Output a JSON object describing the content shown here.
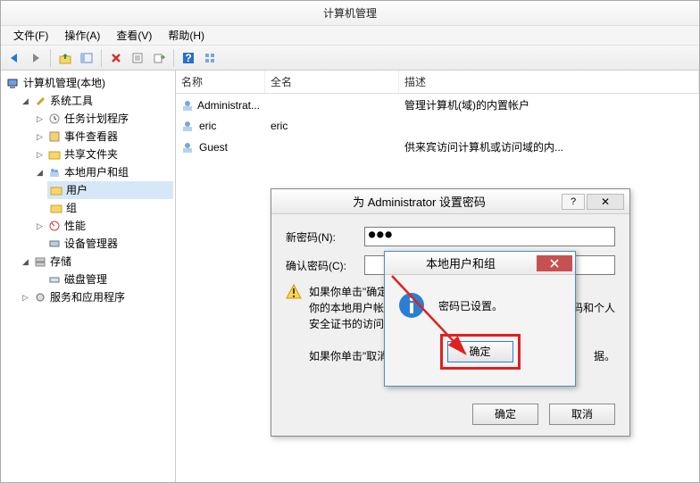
{
  "window": {
    "title": "计算机管理"
  },
  "menu": {
    "file": "文件(F)",
    "action": "操作(A)",
    "view": "查看(V)",
    "help": "帮助(H)"
  },
  "tree": {
    "root": "计算机管理(本地)",
    "system_tools": "系统工具",
    "task_scheduler": "任务计划程序",
    "event_viewer": "事件查看器",
    "shared_folders": "共享文件夹",
    "local_users_groups": "本地用户和组",
    "users": "用户",
    "groups": "组",
    "performance": "性能",
    "device_manager": "设备管理器",
    "storage": "存储",
    "disk_mgmt": "磁盘管理",
    "services_apps": "服务和应用程序"
  },
  "list": {
    "col_name": "名称",
    "col_fullname": "全名",
    "col_desc": "描述",
    "rows": [
      {
        "name": "Administrat...",
        "fullname": "",
        "desc": "管理计算机(域)的内置帐户"
      },
      {
        "name": "eric",
        "fullname": "eric",
        "desc": ""
      },
      {
        "name": "Guest",
        "fullname": "",
        "desc": "供来宾访问计算机或访问域的内..."
      }
    ]
  },
  "dlg_pwd": {
    "title": "为 Administrator 设置密码",
    "help": "?",
    "label_new": "新密码(N):",
    "label_confirm": "确认密码(C):",
    "value_new": "●●●",
    "value_confirm": "",
    "warn_l1": "如果你单击\"确定",
    "warn_l2a": "你的本地用户帐",
    "warn_l2b": "，保存的密码和个人",
    "warn_l3": "安全证书的访问",
    "warn_l4a": "如果你单击\"取消\"，密",
    "warn_l4b": "据。",
    "btn_ok": "确定",
    "btn_cancel": "取消"
  },
  "dlg_confirm": {
    "title": "本地用户和组",
    "msg": "密码已设置。",
    "btn_ok": "确定"
  }
}
